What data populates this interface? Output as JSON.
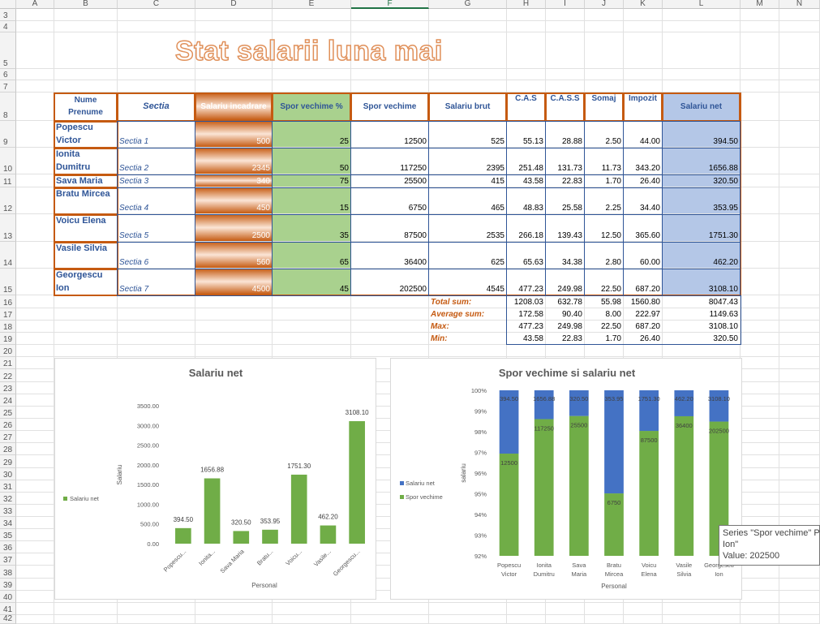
{
  "columns": [
    "A",
    "B",
    "C",
    "D",
    "E",
    "F",
    "G",
    "H",
    "I",
    "J",
    "K",
    "L",
    "M",
    "N"
  ],
  "rows": [
    "3",
    "4",
    "5",
    "6",
    "7",
    "8",
    "9",
    "10",
    "11",
    "12",
    "13",
    "14",
    "15",
    "16",
    "17",
    "18",
    "19",
    "20",
    "21",
    "22",
    "23",
    "24",
    "25",
    "26",
    "27",
    "28",
    "29",
    "30",
    "31",
    "32",
    "33",
    "34",
    "35",
    "36",
    "37",
    "38",
    "39",
    "40",
    "41",
    "42"
  ],
  "title": "Stat salarii luna mai",
  "headers": {
    "name": "Nume Prenume",
    "section": "Sectia",
    "salary": "Salariu incadrare",
    "bonus_pct": "Spor vechime %",
    "bonus": "Spor vechime",
    "gross": "Salariu brut",
    "cas": "C.A.S",
    "cass": "C.A.S.S",
    "somaj": "Somaj",
    "tax": "Impozit",
    "net": "Salariu net"
  },
  "employees": [
    {
      "name": "Popescu Victor",
      "section": "Sectia 1",
      "salary": "500",
      "pct": "25",
      "bonus": "12500",
      "gross": "525",
      "cas": "55.13",
      "cass": "28.88",
      "somaj": "2.50",
      "tax": "44.00",
      "net": "394.50"
    },
    {
      "name": "Ionita Dumitru",
      "section": "Sectia 2",
      "salary": "2345",
      "pct": "50",
      "bonus": "117250",
      "gross": "2395",
      "cas": "251.48",
      "cass": "131.73",
      "somaj": "11.73",
      "tax": "343.20",
      "net": "1656.88"
    },
    {
      "name": "Sava Maria",
      "section": "Sectia 3",
      "salary": "340",
      "pct": "75",
      "bonus": "25500",
      "gross": "415",
      "cas": "43.58",
      "cass": "22.83",
      "somaj": "1.70",
      "tax": "26.40",
      "net": "320.50"
    },
    {
      "name": "Bratu Mircea",
      "section": "Sectia 4",
      "salary": "450",
      "pct": "15",
      "bonus": "6750",
      "gross": "465",
      "cas": "48.83",
      "cass": "25.58",
      "somaj": "2.25",
      "tax": "34.40",
      "net": "353.95"
    },
    {
      "name": "Voicu Elena",
      "section": "Sectia 5",
      "salary": "2500",
      "pct": "35",
      "bonus": "87500",
      "gross": "2535",
      "cas": "266.18",
      "cass": "139.43",
      "somaj": "12.50",
      "tax": "365.60",
      "net": "1751.30"
    },
    {
      "name": "Vasile Silvia",
      "section": "Sectia 6",
      "salary": "560",
      "pct": "65",
      "bonus": "36400",
      "gross": "625",
      "cas": "65.63",
      "cass": "34.38",
      "somaj": "2.80",
      "tax": "60.00",
      "net": "462.20"
    },
    {
      "name": "Georgescu Ion",
      "section": "Sectia 7",
      "salary": "4500",
      "pct": "45",
      "bonus": "202500",
      "gross": "4545",
      "cas": "477.23",
      "cass": "249.98",
      "somaj": "22.50",
      "tax": "687.20",
      "net": "3108.10"
    }
  ],
  "stats": [
    {
      "label": "Total sum:",
      "cas": "1208.03",
      "cass": "632.78",
      "somaj": "55.98",
      "tax": "1560.80",
      "net": "8047.43"
    },
    {
      "label": "Average sum:",
      "cas": "172.58",
      "cass": "90.40",
      "somaj": "8.00",
      "tax": "222.97",
      "net": "1149.63"
    },
    {
      "label": "Max:",
      "cas": "477.23",
      "cass": "249.98",
      "somaj": "22.50",
      "tax": "687.20",
      "net": "3108.10"
    },
    {
      "label": "Min:",
      "cas": "43.58",
      "cass": "22.83",
      "somaj": "1.70",
      "tax": "26.40",
      "net": "320.50"
    }
  ],
  "colors": {
    "orange": "#c55a11",
    "navy": "#2f5597",
    "green": "#70ad47",
    "blue": "#4472c4"
  },
  "chart_data": [
    {
      "type": "bar",
      "title": "Salariu net",
      "xlabel": "Personal",
      "ylabel": "Salariu",
      "categories": [
        "Popescu...",
        "Ionita...",
        "Sava Maria",
        "Bratu...",
        "Voicu...",
        "Vasile...",
        "Georgescu..."
      ],
      "series": [
        {
          "name": "Salariu net",
          "values": [
            394.5,
            1656.88,
            320.5,
            353.95,
            1751.3,
            462.2,
            3108.1
          ]
        }
      ],
      "data_labels": [
        "394.50",
        "1656.88",
        "320.50",
        "353.95",
        "1751.30",
        "462.20",
        "3108.10"
      ],
      "yticks": [
        "0.00",
        "500.00",
        "1000.00",
        "1500.00",
        "2000.00",
        "2500.00",
        "3000.00",
        "3500.00"
      ],
      "ylim": [
        0,
        3500
      ],
      "legend": "left",
      "grid": false
    },
    {
      "type": "bar",
      "stacked": "percent",
      "title": "Spor vechime si salariu net",
      "xlabel": "Personal",
      "ylabel": "salariu",
      "categories": [
        "Popescu Victor",
        "Ionita Dumitru",
        "Sava Maria",
        "Bratu Mircea",
        "Voicu Elena",
        "Vasile Silvia",
        "Georgescu Ion"
      ],
      "series": [
        {
          "name": "Spor vechime",
          "values": [
            12500,
            117250,
            25500,
            6750,
            87500,
            36400,
            202500
          ],
          "labels": [
            "12500",
            "117250",
            "25500",
            "6750",
            "87500",
            "36400",
            "202500"
          ]
        },
        {
          "name": "Salariu net",
          "values": [
            394.5,
            1656.88,
            320.5,
            353.95,
            1751.3,
            462.2,
            3108.1
          ],
          "labels": [
            "394.50",
            "1656.88",
            "320.50",
            "353.95",
            "1751.30",
            "462.20",
            "3108.10"
          ]
        }
      ],
      "yticks": [
        "92%",
        "93%",
        "94%",
        "95%",
        "96%",
        "97%",
        "98%",
        "99%",
        "100%"
      ],
      "ylim": [
        92,
        100
      ],
      "legend": "left",
      "grid": false
    }
  ],
  "tooltip": {
    "text": "Series \"Spor vechime\" P\nIon\"\nValue: 202500"
  }
}
